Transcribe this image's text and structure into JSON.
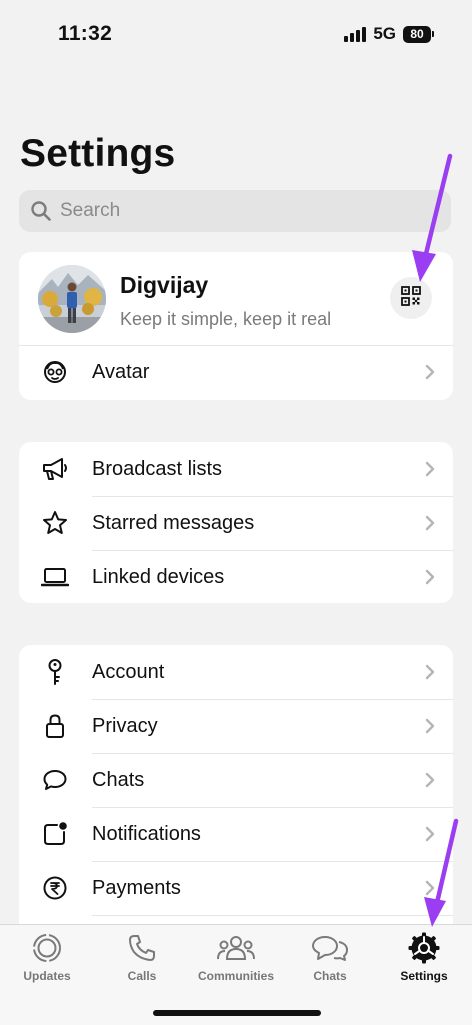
{
  "status_bar": {
    "time": "11:32",
    "network": "5G",
    "battery": "80"
  },
  "header": {
    "title": "Settings"
  },
  "search": {
    "placeholder": "Search"
  },
  "profile": {
    "name": "Digvijay",
    "status": "Keep it simple, keep it real"
  },
  "avatar_row": {
    "label": "Avatar"
  },
  "lists": [
    {
      "label": "Broadcast lists",
      "icon": "megaphone-icon"
    },
    {
      "label": "Starred messages",
      "icon": "star-icon"
    },
    {
      "label": "Linked devices",
      "icon": "laptop-icon"
    }
  ],
  "account_items": [
    {
      "label": "Account",
      "icon": "key-icon"
    },
    {
      "label": "Privacy",
      "icon": "lock-icon"
    },
    {
      "label": "Chats",
      "icon": "chat-bubble-icon"
    },
    {
      "label": "Notifications",
      "icon": "notification-icon"
    },
    {
      "label": "Payments",
      "icon": "rupee-icon"
    }
  ],
  "tabs": [
    {
      "label": "Updates",
      "icon": "updates-icon"
    },
    {
      "label": "Calls",
      "icon": "phone-icon"
    },
    {
      "label": "Communities",
      "icon": "communities-icon"
    },
    {
      "label": "Chats",
      "icon": "chats-icon"
    },
    {
      "label": "Settings",
      "icon": "settings-gear-icon",
      "active": true
    }
  ],
  "colors": {
    "annotation_arrow": "#9b3df0",
    "background": "#f2f2f2",
    "card": "#ffffff"
  }
}
